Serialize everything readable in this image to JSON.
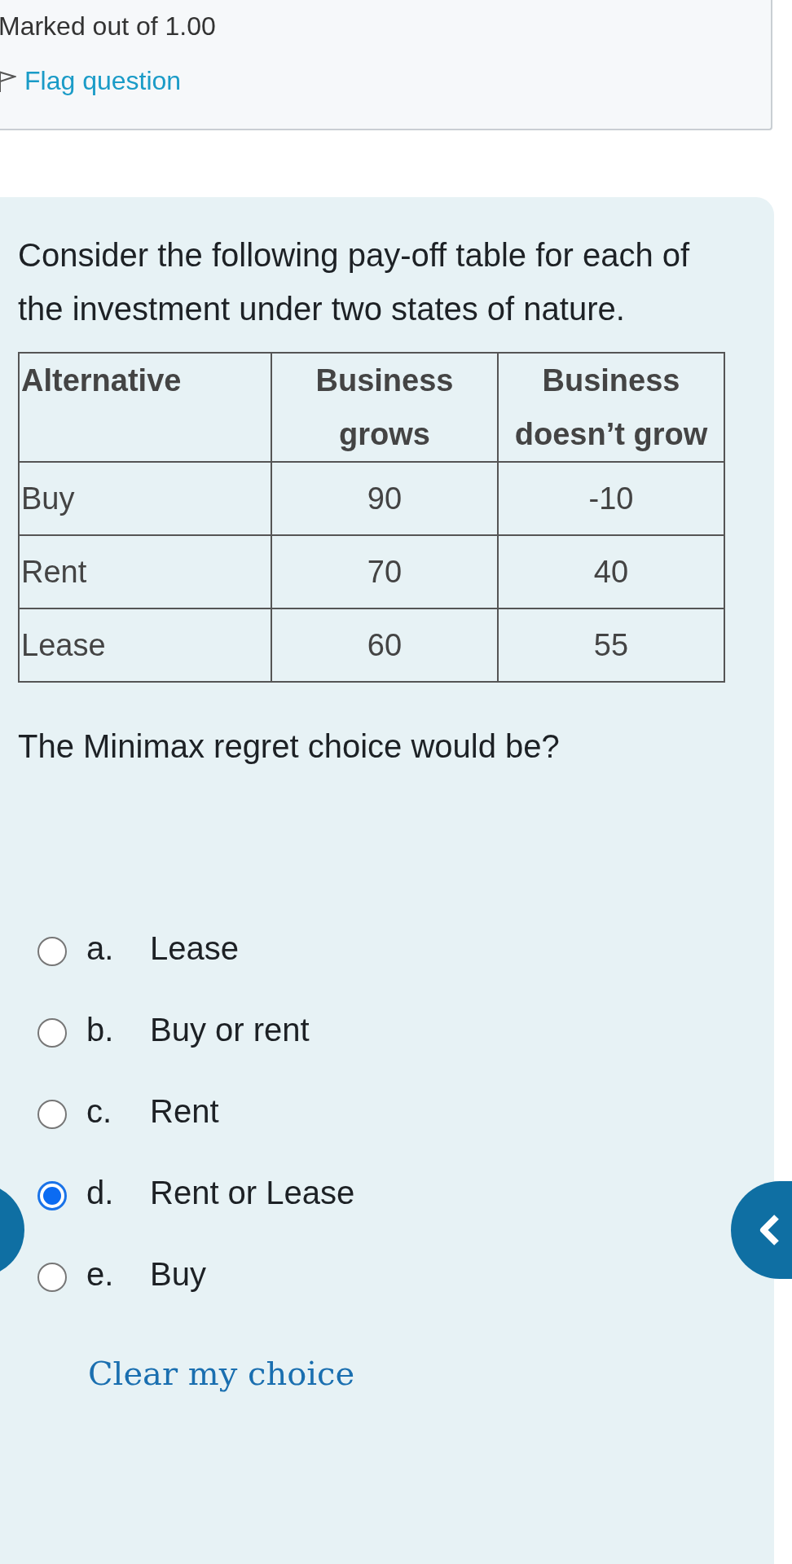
{
  "info": {
    "marked": "Marked out of 1.00",
    "flag_link": "Flag question"
  },
  "question": {
    "intro": "Consider the following pay-off table for each of the investment under two states of nature.",
    "table": {
      "columns": [
        "Alternative",
        "Business grows",
        "Business doesn’t grow"
      ],
      "rows": [
        [
          "Buy",
          "90",
          "-10"
        ],
        [
          "Rent",
          "70",
          "40"
        ],
        [
          "Lease",
          "60",
          "55"
        ]
      ]
    },
    "prompt": "The Minimax regret choice would be?",
    "options": [
      {
        "letter": "a.",
        "text": "Lease",
        "selected": false
      },
      {
        "letter": "b.",
        "text": "Buy or rent",
        "selected": false
      },
      {
        "letter": "c.",
        "text": "Rent",
        "selected": false
      },
      {
        "letter": "d.",
        "text": "Rent or Lease",
        "selected": true
      },
      {
        "letter": "e.",
        "text": "Buy",
        "selected": false
      }
    ],
    "clear_link": "Clear my choice"
  }
}
